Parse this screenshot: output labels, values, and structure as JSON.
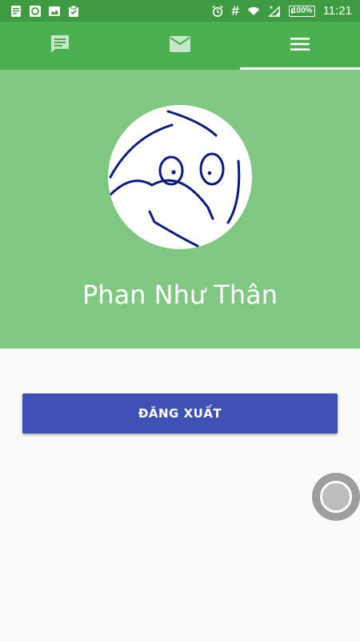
{
  "status_bar": {
    "left_icons": [
      "notes-icon",
      "chat-bubble-icon",
      "image-icon",
      "clipboard-check-icon"
    ],
    "right_icons": [
      "alarm-icon",
      "hash-icon",
      "wifi-icon",
      "signal-icon"
    ],
    "hash_symbol": "#",
    "battery": "100%",
    "time": "11:21"
  },
  "tabs": [
    {
      "icon": "message-icon",
      "active": false
    },
    {
      "icon": "mail-icon",
      "active": false
    },
    {
      "icon": "menu-icon",
      "active": true
    }
  ],
  "profile": {
    "avatar_icon": "user-doodle-avatar",
    "name": "Phan Như Thân"
  },
  "actions": {
    "logout_label": "ĐĂNG XUẤT"
  },
  "floating_button": {
    "icon": "circle-icon"
  },
  "colors": {
    "status_bar": "#3e9b41",
    "tab_bar": "#4caf50",
    "header": "#81c784",
    "button": "#3f51b5",
    "background": "#fafafa"
  }
}
